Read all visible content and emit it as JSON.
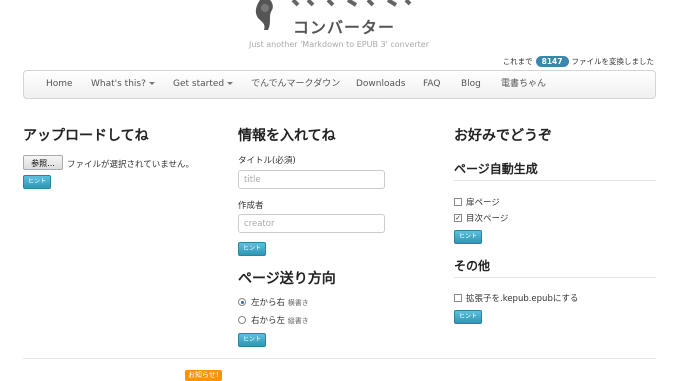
{
  "logo": {
    "text": "コンバーター",
    "tagline": "Just another 'Markdown to EPUB 3' converter"
  },
  "counter": {
    "prefix": "これまで",
    "count": "8147",
    "suffix": "ファイルを変換しました"
  },
  "nav": {
    "items": [
      {
        "label": "Home"
      },
      {
        "label": "What's this?"
      },
      {
        "label": "Get started"
      },
      {
        "label": "でんでんマークダウン"
      },
      {
        "label": "Downloads"
      },
      {
        "label": "FAQ"
      },
      {
        "label": "Blog"
      },
      {
        "label": "電書ちゃん"
      }
    ]
  },
  "upload": {
    "heading": "アップロードしてね",
    "browse_label": "参照...",
    "no_file_text": "ファイルが選択されていません。",
    "hint_label": "ヒント"
  },
  "info": {
    "heading": "情報を入れてね",
    "title_label": "タイトル(必須)",
    "title_placeholder": "title",
    "author_label": "作成者",
    "author_placeholder": "creator",
    "hint_label": "ヒント"
  },
  "direction": {
    "heading": "ページ送り方向",
    "ltr_label": "左から右",
    "ltr_note": "横書き",
    "rtl_label": "右から左",
    "rtl_note": "縦書き",
    "selected": "ltr",
    "hint_label": "ヒント"
  },
  "prefs": {
    "heading": "お好みでどうぞ",
    "autogen_heading": "ページ自動生成",
    "cover_label": "扉ページ",
    "cover_checked": false,
    "toc_label": "目次ページ",
    "toc_checked": true,
    "hint_label": "ヒント",
    "other_heading": "その他",
    "kepub_label": "拡張子を.kepub.epubにする",
    "kepub_checked": false,
    "hint2_label": "ヒント"
  },
  "footer": {
    "notice_label": "お知らせ!"
  },
  "colors": {
    "accent": "#3a87ad",
    "button": "#49afcd",
    "notice": "#f89406"
  }
}
